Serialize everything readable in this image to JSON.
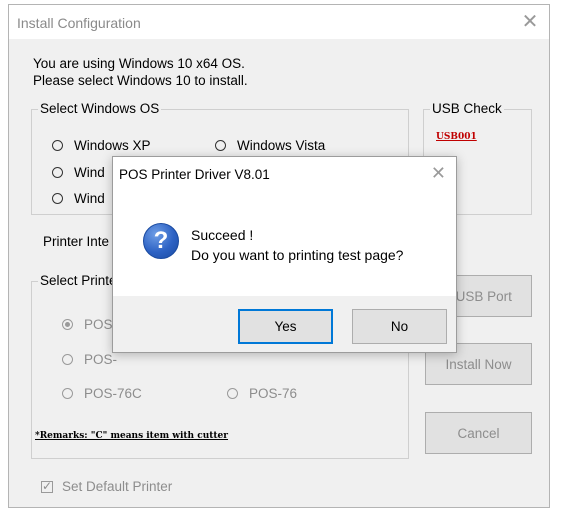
{
  "window": {
    "title": "Install Configuration",
    "close_glyph": "✕"
  },
  "info": {
    "line1": "You are using Windows 10 x64 OS.",
    "line2": "Please select Windows 10 to install."
  },
  "os_group": {
    "label": "Select Windows OS",
    "options": [
      "Windows XP",
      "Windows Vista",
      "Wind",
      "Wind"
    ]
  },
  "usb_group": {
    "label": "USB Check",
    "device": "USB001"
  },
  "printer_interface_label": "Printer Inte",
  "printer_group": {
    "label": "Select Printe",
    "options": [
      "POS-",
      "POS-",
      "POS-76C",
      "POS-76"
    ],
    "selected_index": 0
  },
  "remarks": "*Remarks: \"C\" means item with cutter",
  "default_printer": {
    "label": "Set Default Printer",
    "checked": true
  },
  "buttons": {
    "check_usb": "k USB Port",
    "install_now": "Install Now",
    "cancel": "Cancel"
  },
  "dialog": {
    "title": "POS Printer Driver V8.01",
    "close_glyph": "✕",
    "icon_glyph": "?",
    "message_line1": "Succeed !",
    "message_line2": "Do you want to printing test page?",
    "yes": "Yes",
    "no": "No"
  },
  "colors": {
    "usb_text": "#c00000",
    "disabled_text": "#8d8d8d",
    "focus_border": "#0078d7"
  },
  "icons": {
    "dialog_icon": "question-icon",
    "window_close": "close-icon"
  }
}
